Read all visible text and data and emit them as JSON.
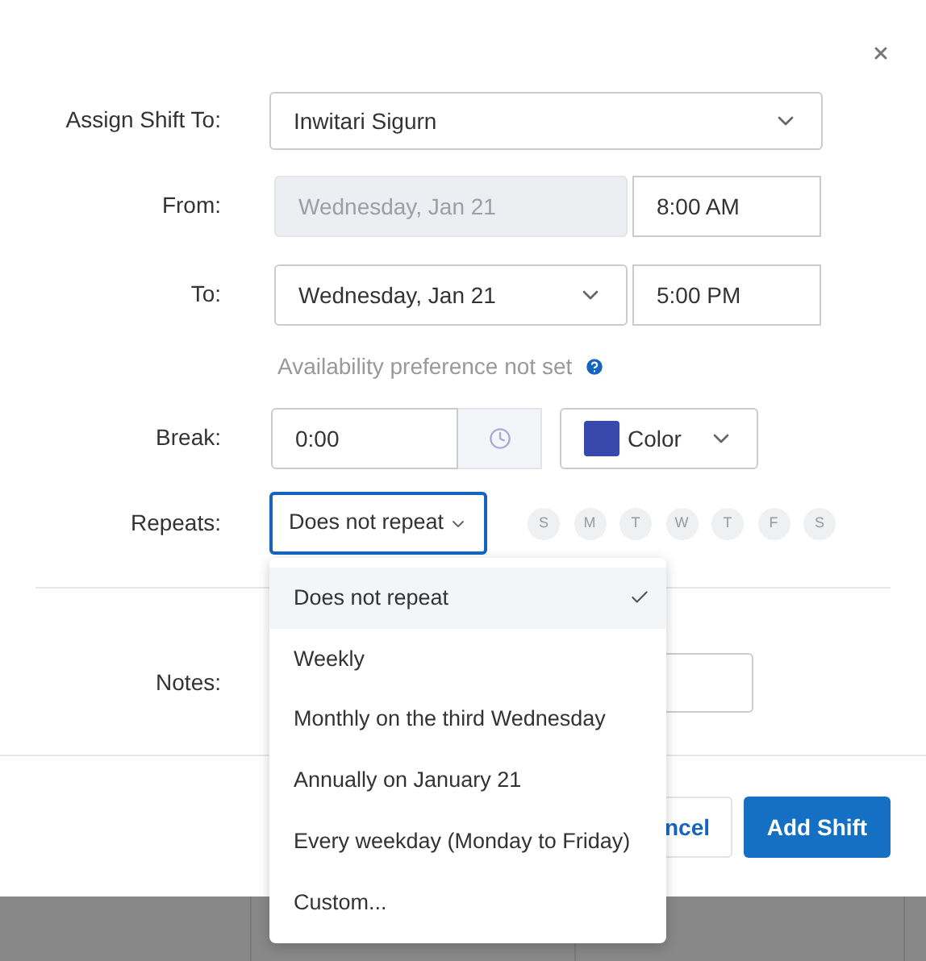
{
  "form": {
    "assign": {
      "label": "Assign Shift To:",
      "value": "Inwitari Sigurn"
    },
    "from": {
      "label": "From:",
      "date": "Wednesday, Jan 21",
      "date_disabled": true,
      "time": "8:00 AM"
    },
    "to": {
      "label": "To:",
      "date": "Wednesday, Jan 21",
      "date_disabled": false,
      "time": "5:00 PM"
    },
    "availability_note": "Availability preference not set",
    "break": {
      "label": "Break:",
      "value": "0:00",
      "color_label": "Color",
      "color": "#3949ab"
    },
    "repeats": {
      "label": "Repeats:",
      "value": "Does not repeat",
      "days": [
        {
          "label": "S",
          "selected": false
        },
        {
          "label": "M",
          "selected": false
        },
        {
          "label": "T",
          "selected": false
        },
        {
          "label": "W",
          "selected": false
        },
        {
          "label": "T",
          "selected": false
        },
        {
          "label": "F",
          "selected": false
        },
        {
          "label": "S",
          "selected": false
        }
      ]
    },
    "notes": {
      "label": "Notes:"
    }
  },
  "buttons": [
    {
      "label": "ncel",
      "kind": "secondary"
    },
    {
      "label": "Add Shift",
      "kind": "primary"
    }
  ],
  "dropdown": {
    "options": [
      {
        "label": "Does not repeat",
        "selected": true
      },
      {
        "label": "Weekly",
        "selected": false
      },
      {
        "label": "Monthly on the third Wednesday",
        "selected": false
      },
      {
        "label": "Annually on January 21",
        "selected": false
      },
      {
        "label": "Every weekday (Monday to Friday)",
        "selected": false
      },
      {
        "label": "Custom...",
        "selected": false
      }
    ]
  }
}
